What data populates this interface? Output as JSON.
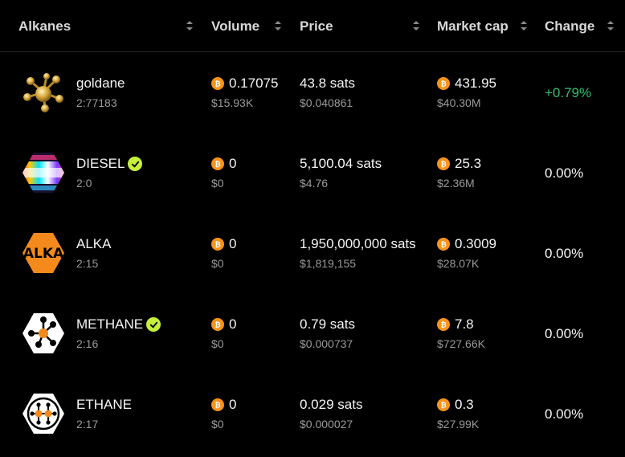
{
  "header": {
    "alkanes": "Alkanes",
    "volume": "Volume",
    "price": "Price",
    "market_cap": "Market cap",
    "change": "Change"
  },
  "colors": {
    "background": "#000000",
    "positive": "#2fbf71",
    "bitcoin": "#f7931a",
    "verified": "#c6f03a"
  },
  "rows": [
    {
      "name": "goldane",
      "id": "2:77183",
      "verified": false,
      "icon": "goldane-molecule-icon",
      "volume": "0.17075",
      "volume_usd": "$15.93K",
      "price": "43.8 sats",
      "price_usd": "$0.040861",
      "market_cap": "431.95",
      "market_cap_usd": "$40.30M",
      "change": "+0.79%",
      "change_dir": "up"
    },
    {
      "name": "DIESEL",
      "id": "2:0",
      "verified": true,
      "icon": "diesel-hexagon-icon",
      "volume": "0",
      "volume_usd": "$0",
      "price": "5,100.04 sats",
      "price_usd": "$4.76",
      "market_cap": "25.3",
      "market_cap_usd": "$2.36M",
      "change": "0.00%",
      "change_dir": "flat"
    },
    {
      "name": "ALKA",
      "id": "2:15",
      "verified": false,
      "icon": "alka-hexagon-icon",
      "volume": "0",
      "volume_usd": "$0",
      "price": "1,950,000,000 sats",
      "price_usd": "$1,819,155",
      "market_cap": "0.3009",
      "market_cap_usd": "$28.07K",
      "change": "0.00%",
      "change_dir": "flat"
    },
    {
      "name": "METHANE",
      "id": "2:16",
      "verified": true,
      "icon": "methane-molecule-icon",
      "volume": "0",
      "volume_usd": "$0",
      "price": "0.79 sats",
      "price_usd": "$0.000737",
      "market_cap": "7.8",
      "market_cap_usd": "$727.66K",
      "change": "0.00%",
      "change_dir": "flat"
    },
    {
      "name": "ETHANE",
      "id": "2:17",
      "verified": false,
      "icon": "ethane-molecule-icon",
      "volume": "0",
      "volume_usd": "$0",
      "price": "0.029 sats",
      "price_usd": "$0.000027",
      "market_cap": "0.3",
      "market_cap_usd": "$27.99K",
      "change": "0.00%",
      "change_dir": "flat"
    }
  ],
  "alka_logo_text": "ALKA"
}
